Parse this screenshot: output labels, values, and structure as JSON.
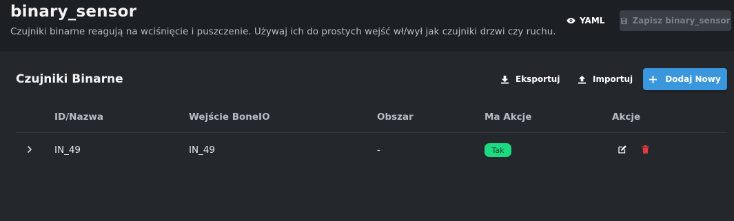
{
  "header": {
    "title": "binary_sensor",
    "description": "Czujniki binarne reagują na wciśnięcie i puszczenie. Używaj ich do prostych wejść wł/wył jak czujniki drzwi czy ruchu.",
    "yaml_label": "YAML",
    "save_label": "Zapisz binary_sensor"
  },
  "card": {
    "title": "Czujniki Binarne",
    "export_label": "Eksportuj",
    "import_label": "Importuj",
    "add_label": "Dodaj Nowy"
  },
  "table": {
    "columns": [
      "ID/Nazwa",
      "Wejście BoneIO",
      "Obszar",
      "Ma Akcje",
      "Akcje"
    ],
    "rows": [
      {
        "id_name": "IN_49",
        "input": "IN_49",
        "area": "-",
        "has_actions": "Tak"
      }
    ]
  },
  "colors": {
    "background": "#1c1f24",
    "card": "#24272c",
    "accent": "#3a97dd",
    "badge": "#1dd97f",
    "delete": "#e0393e"
  },
  "icons": {
    "yaml": "eye-icon",
    "save": "floppy-disk-icon",
    "export": "download-icon",
    "import": "upload-icon",
    "add": "plus-icon",
    "expand": "chevron-right-icon",
    "edit": "edit-icon",
    "delete": "trash-icon"
  }
}
